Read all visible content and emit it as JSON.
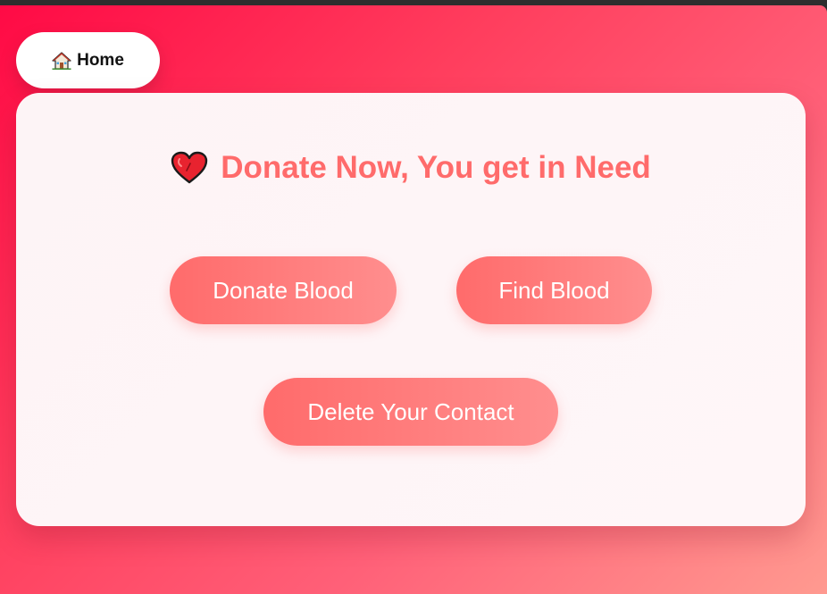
{
  "nav": {
    "home_label": "Home",
    "home_icon": "house-icon"
  },
  "card": {
    "headline": "Donate Now, You get in Need",
    "headline_icon": "heart-icon",
    "buttons": {
      "donate_blood": "Donate Blood",
      "find_blood": "Find Blood",
      "delete_contact": "Delete Your Contact"
    }
  },
  "colors": {
    "accent": "#ff6b6b",
    "background_start": "#ff0a45",
    "background_end": "#ff9a90",
    "card_bg": "#fdf4f6"
  }
}
